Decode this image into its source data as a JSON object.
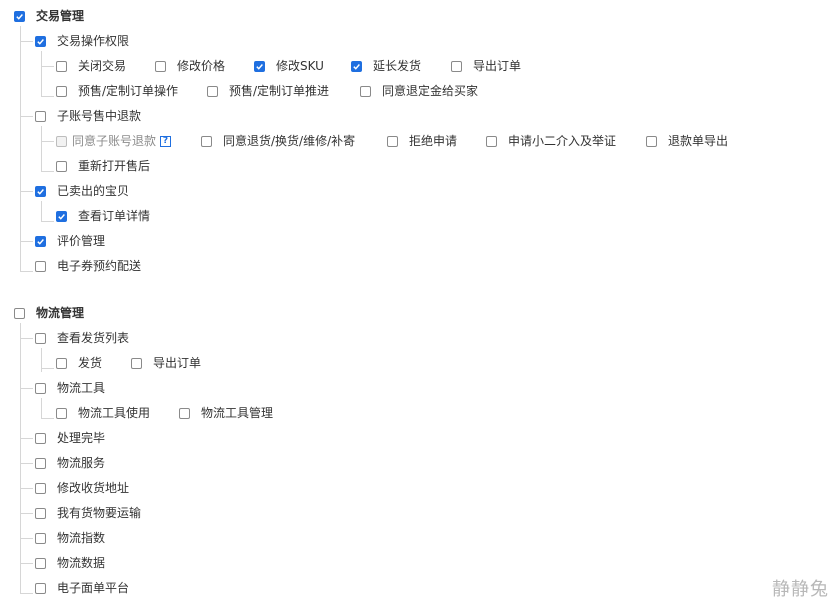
{
  "trade": {
    "title": "交易管理",
    "ops": {
      "label": "交易操作权限",
      "close": "关闭交易",
      "price": "修改价格",
      "sku": "修改SKU",
      "delay": "延长发货",
      "export": "导出订单",
      "presale_op": "预售/定制订单操作",
      "presale_push": "预售/定制订单推进",
      "refund_buyer": "同意退定金给买家"
    },
    "sub_refund": {
      "label": "子账号售中退款",
      "agree_sub": "同意子账号退款",
      "help": "?",
      "agree_return": "同意退货/换货/维修/补寄",
      "reject": "拒绝申请",
      "apply_xiaoer": "申请小二介入及举证",
      "export_refund": "退款单导出",
      "reopen": "重新打开售后"
    },
    "sold": {
      "label": "已卖出的宝贝",
      "view_detail": "查看订单详情"
    },
    "review": "评价管理",
    "ecoupon": "电子券预约配送"
  },
  "logistics": {
    "title": "物流管理",
    "ship_list": {
      "label": "查看发货列表",
      "ship": "发货",
      "export": "导出订单"
    },
    "tools": {
      "label": "物流工具",
      "use": "物流工具使用",
      "manage": "物流工具管理"
    },
    "done": "处理完毕",
    "service": "物流服务",
    "address": "修改收货地址",
    "transport": "我有货物要运输",
    "index": "物流指数",
    "data": "物流数据",
    "waybill": "电子面单平台"
  },
  "watermark": "静静兔",
  "checked": [
    "trade",
    "ops",
    "sku",
    "delay",
    "sold",
    "view_detail",
    "review"
  ]
}
